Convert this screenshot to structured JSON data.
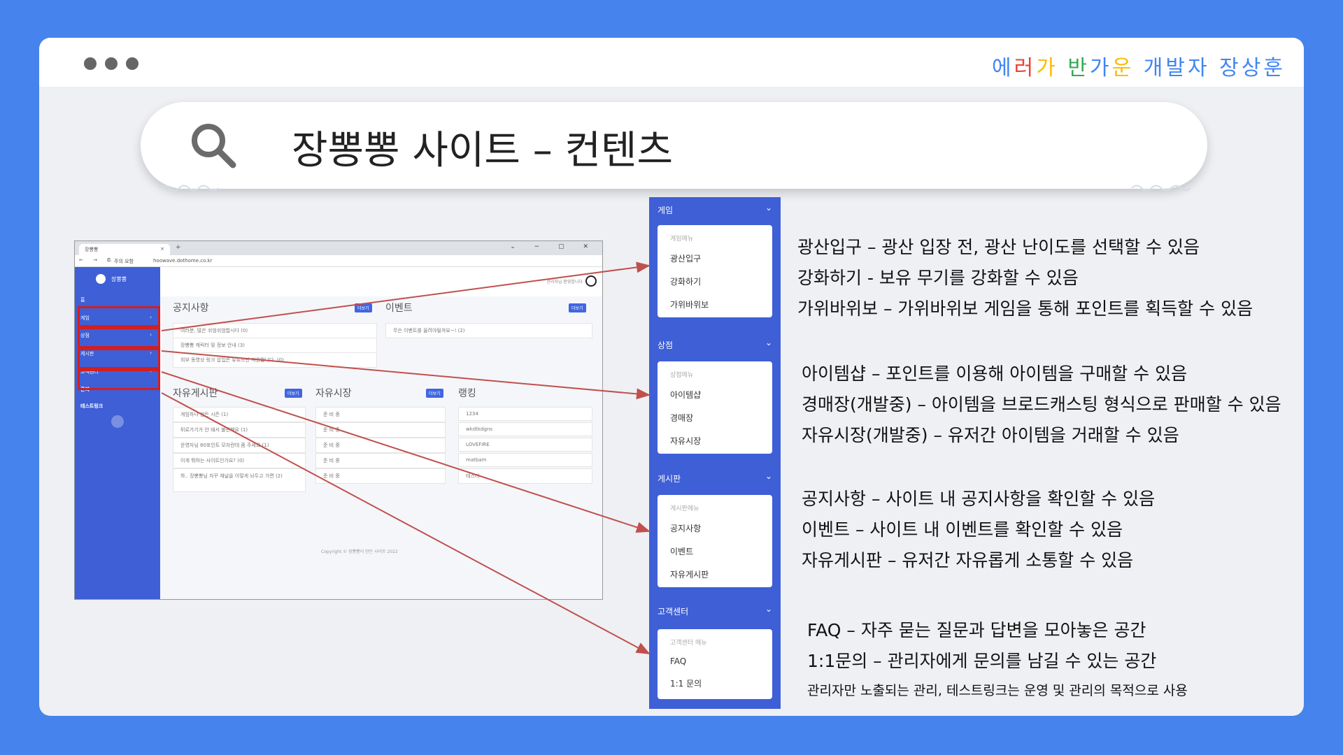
{
  "brand": {
    "chars": [
      "에",
      "러",
      "가",
      " ",
      "반",
      "가",
      "운",
      " ",
      "개",
      "발",
      "자",
      " ",
      "장",
      "상",
      "훈"
    ],
    "colors": [
      "#4285f4",
      "#ea4335",
      "#fbbc05",
      "#000000",
      "#34a853",
      "#4285f4",
      "#fbbc05",
      "#000000",
      "#4285f4",
      "#4285f4",
      "#4285f4",
      "#000000",
      "#4285f4",
      "#4285f4",
      "#4285f4"
    ]
  },
  "title": "장뽕뽕 사이트 – 컨텐츠",
  "mini": {
    "tab": "장뽕뽕",
    "url": "hoowave.dothome.co.kr",
    "nav": "← → C",
    "warn": "주의 요함",
    "site_name": "장뽕뽕",
    "welcome": "관리자님 환영합니다",
    "sidebar": [
      "홈",
      "게임",
      "상점",
      "게시판",
      "고객센터",
      "관리",
      "테스트링크"
    ],
    "notice_title": "공지사항",
    "event_title": "이벤트",
    "more": "더보기",
    "notices": [
      "여러분, 많은 쉬엄쉬엄합시다 (0)",
      "장뽕뽕 캐릭터 및 정보 안내 (3)",
      "외부 동영상 링크 삽입은 유튜브만 지원합니다. (0)"
    ],
    "events": [
      "무슨 이벤트를 올려야될까요~! (2)"
    ],
    "free_title": "자유게시판",
    "market_title": "자유시장",
    "rank_title": "랭킹",
    "free_posts": [
      "게임하나 만든 시즌 (1)",
      "뒤로가기가 안 돼서 불편해요 (1)",
      "운영자님 80포인트 모자란데 좀 주세요 (1)",
      "이게 뭐하는 사이트인가요? (0)",
      "하.. 장뽕뽕님 자꾸 채널을 이렇게 놔두고 가면 (2)"
    ],
    "market": [
      "준 비 중",
      "준 비 중",
      "준 비 중",
      "준 비 중",
      "준 비 중"
    ],
    "ranking": [
      "1234",
      "wkdtkdgns",
      "LOVEFIRE",
      "matbam",
      "테스터"
    ],
    "footer": "Copyright © 장뽕뽕이 만든 사이트 2022"
  },
  "panels": [
    {
      "title": "게임",
      "sub": "게임메뉴",
      "items": [
        "광산입구",
        "강화하기",
        "가위바위보"
      ]
    },
    {
      "title": "상점",
      "sub": "상점메뉴",
      "items": [
        "아이템샵",
        "경매장",
        "자유시장"
      ]
    },
    {
      "title": "게시판",
      "sub": "게시판메뉴",
      "items": [
        "공지사항",
        "이벤트",
        "자유게시판"
      ]
    },
    {
      "title": "고객센터",
      "sub": "고객센터 메뉴",
      "items": [
        "FAQ",
        "1:1 문의"
      ]
    }
  ],
  "descriptions": [
    [
      "광산입구 – 광산 입장 전, 광산 난이도를 선택할 수 있음",
      "강화하기 - 보유 무기를 강화할 수 있음",
      "가위바위보 – 가위바위보 게임을 통해 포인트를 획득할 수 있음"
    ],
    [
      "아이템샵 – 포인트를 이용해 아이템을 구매할 수 있음",
      "경매장(개발중) – 아이템을 브로드캐스팅 형식으로 판매할 수 있음",
      "자유시장(개발중) – 유저간 아이템을 거래할 수 있음"
    ],
    [
      "공지사항 – 사이트 내 공지사항을 확인할 수 있음",
      "이벤트 – 사이트 내 이벤트를 확인할 수 있음",
      "자유게시판 – 유저간 자유롭게 소통할 수 있음"
    ],
    [
      "FAQ – 자주 묻는 질문과 답변을 모아놓은 공간",
      "1:1문의 – 관리자에게 문의를 남길 수 있는 공간"
    ]
  ],
  "admin_note": "관리자만 노출되는 관리, 테스트링크는 운영 및 관리의 목적으로 사용",
  "colors": {
    "accent_blue": "#3f5fd6",
    "arrow_red": "#c0504d",
    "highlight_red": "#d21f1f",
    "background": "#4683ec"
  }
}
